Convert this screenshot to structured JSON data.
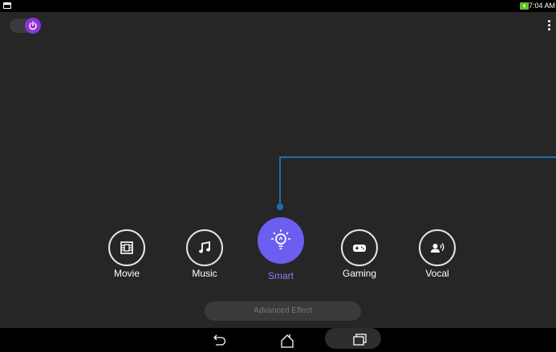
{
  "status_bar": {
    "time": "7:04 AM",
    "battery_color": "#5fbf2b"
  },
  "power": {
    "state": "on",
    "knob_color": "#8a35d6"
  },
  "effects": [
    {
      "label": "Movie",
      "icon": "film-icon",
      "selected": false
    },
    {
      "label": "Music",
      "icon": "music-note-icon",
      "selected": false
    },
    {
      "label": "Smart",
      "icon": "lightbulb-icon",
      "selected": true
    },
    {
      "label": "Gaming",
      "icon": "gamepad-icon",
      "selected": false
    },
    {
      "label": "Vocal",
      "icon": "voice-icon",
      "selected": false
    }
  ],
  "advanced_effect_label": "Advanced Effect",
  "colors": {
    "accent": "#6b5ff0",
    "accent_text": "#8a82f7",
    "connector": "#1f6fb0",
    "background": "#262626"
  },
  "nav": {
    "buttons": [
      "back-icon",
      "home-icon",
      "recents-icon"
    ]
  }
}
